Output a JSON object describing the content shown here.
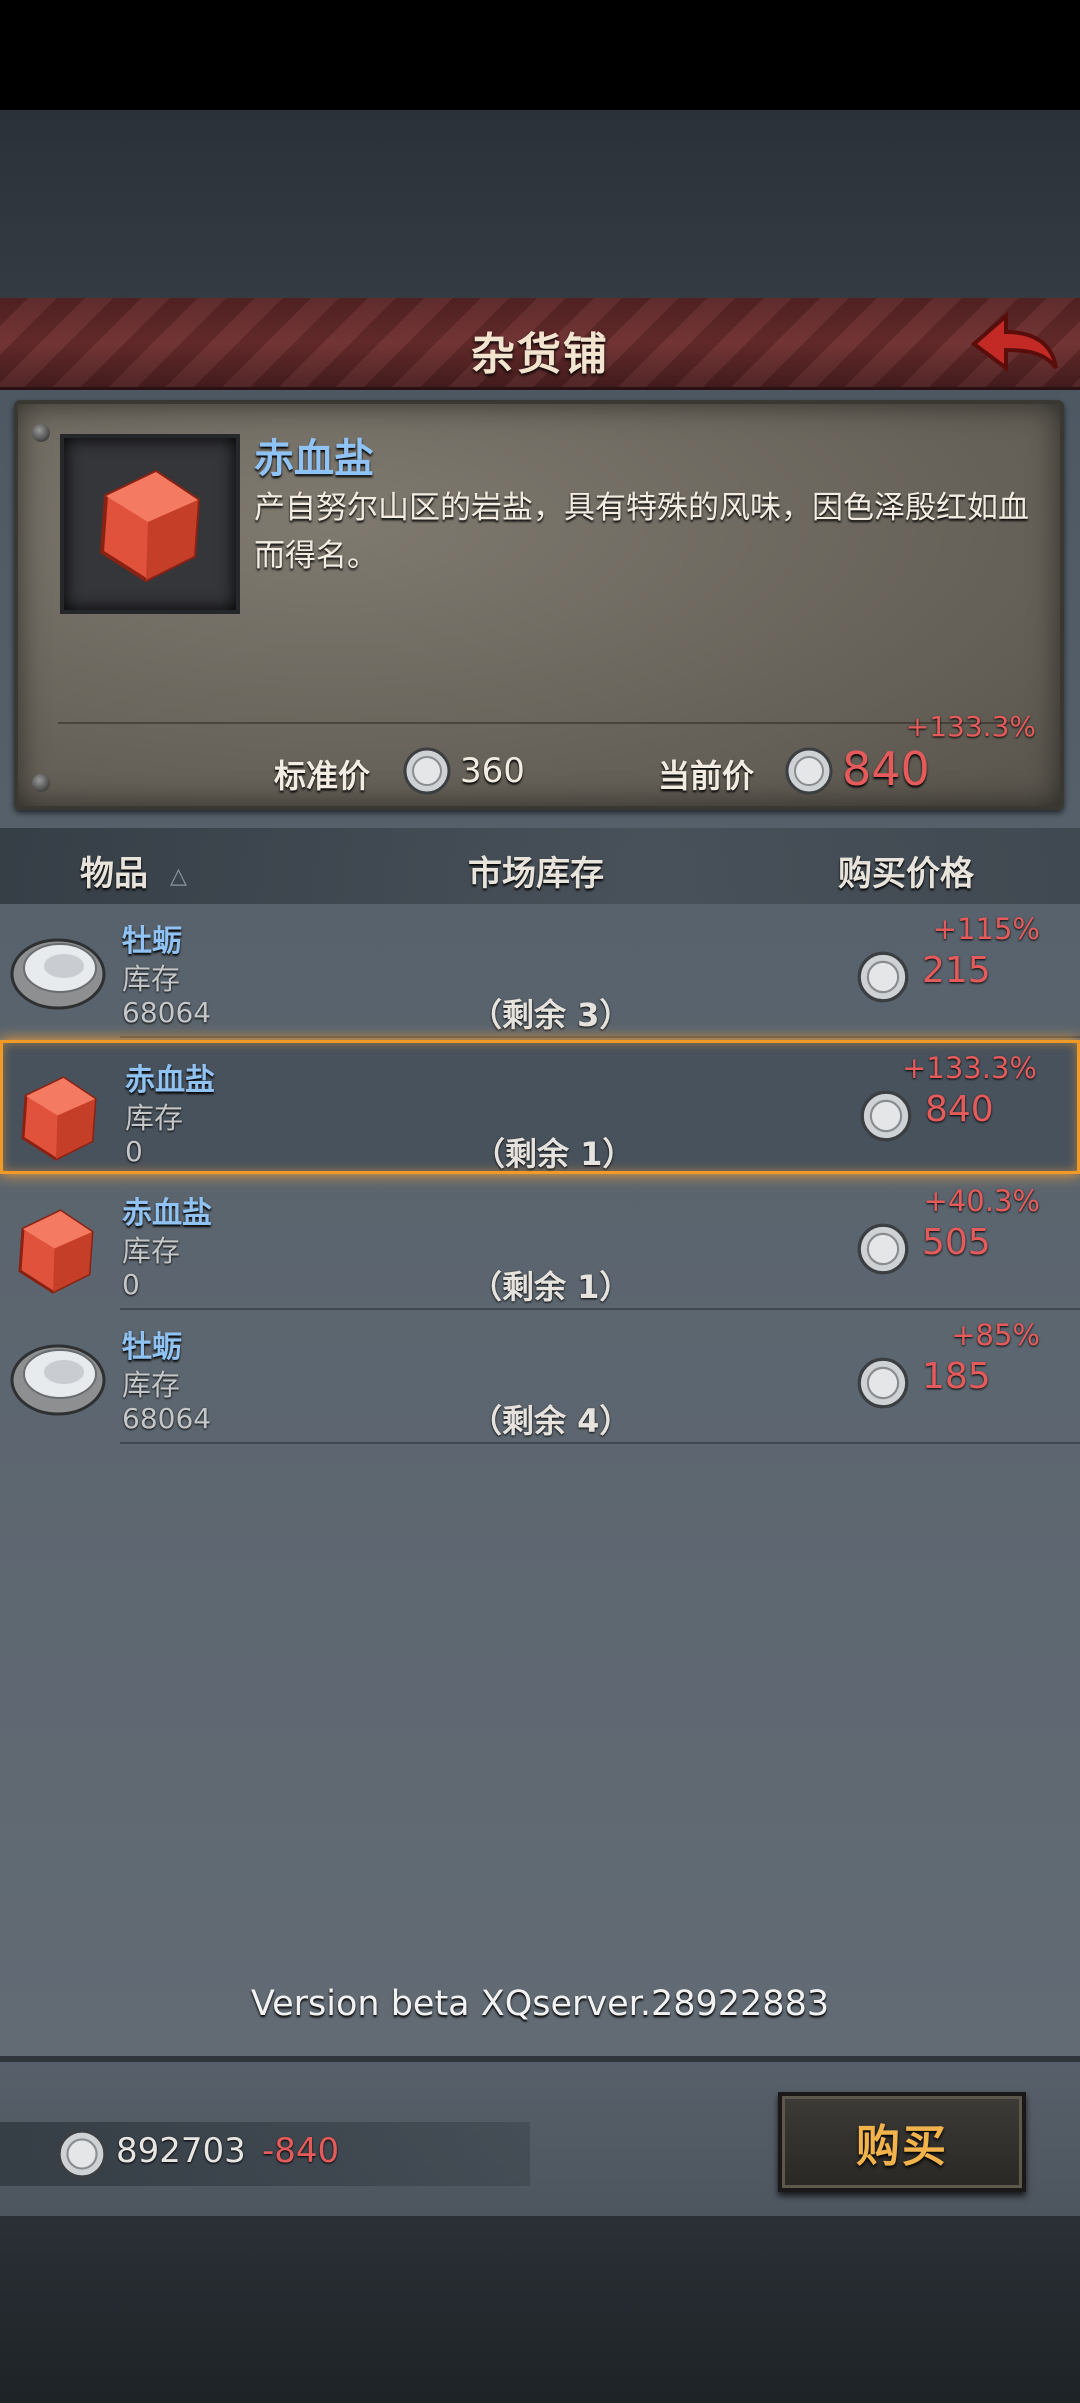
{
  "header": {
    "title": "杂货铺"
  },
  "detail": {
    "name": "赤血盐",
    "description": "产自努尔山区的岩盐，具有特殊的风味，因色泽殷红如血而得名。",
    "standard_price_label": "标准价",
    "standard_price": "360",
    "current_price_label": "当前价",
    "current_price": "840",
    "current_change": "+133.3%"
  },
  "list_header": {
    "item": "物品",
    "stock": "市场库存",
    "price": "购买价格"
  },
  "rows": [
    {
      "name": "牡蛎",
      "stock_label": "库存",
      "stock": "68064",
      "remain": "（剩余 3）",
      "change": "+115%",
      "price": "215",
      "icon": "oyster-icon"
    },
    {
      "name": "赤血盐",
      "stock_label": "库存",
      "stock": "0",
      "remain": "（剩余 1）",
      "change": "+133.3%",
      "price": "840",
      "icon": "red-salt-icon"
    },
    {
      "name": "赤血盐",
      "stock_label": "库存",
      "stock": "0",
      "remain": "（剩余 1）",
      "change": "+40.3%",
      "price": "505",
      "icon": "red-salt-icon"
    },
    {
      "name": "牡蛎",
      "stock_label": "库存",
      "stock": "68064",
      "remain": "（剩余 4）",
      "change": "+85%",
      "price": "185",
      "icon": "oyster-icon"
    }
  ],
  "version": "Version beta XQserver.28922883",
  "footer": {
    "money": "892703",
    "money_delta": "-840",
    "buy_label": "购买"
  },
  "colors": {
    "accent_red": "#e55a5a",
    "name_blue": "#90c3f3",
    "selection": "#f29a28",
    "buy_text": "#f3b34c"
  }
}
